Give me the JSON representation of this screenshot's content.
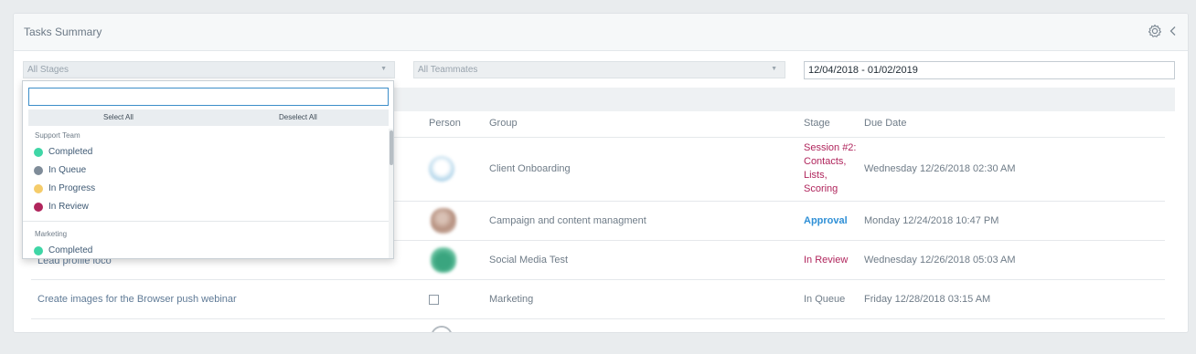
{
  "panel": {
    "title": "Tasks Summary"
  },
  "filters": {
    "stages_placeholder": "All Stages",
    "teammates_placeholder": "All Teammates",
    "date_range": "12/04/2018 - 01/02/2019"
  },
  "table": {
    "headers": [
      "Person",
      "Group",
      "Stage",
      "Due Date"
    ],
    "rows": [
      {
        "task": "",
        "group": "Client Onboarding",
        "stage": "Session #2: Contacts, Lists, Scoring",
        "stage_color": "#b0255c",
        "due": "Wednesday 12/26/2018 02:30 AM"
      },
      {
        "task": "",
        "group": "Campaign and content managment",
        "stage": "Approval",
        "stage_color": "#2e8fd6",
        "due": "Monday 12/24/2018 10:47 PM"
      },
      {
        "task": "Lead profile loco",
        "group": "Social Media Test",
        "stage": "In Review",
        "stage_color": "#b0255c",
        "due": "Wednesday 12/26/2018 05:03 AM"
      },
      {
        "task": "Create images for the Browser push webinar",
        "group": "Marketing",
        "stage": "In Queue",
        "stage_color": "#6f7c88",
        "due": "Friday 12/28/2018 03:15 AM"
      }
    ]
  },
  "dropdown": {
    "search_value": "",
    "select_all": "Select All",
    "deselect_all": "Deselect All",
    "groups": [
      {
        "name": "Support Team",
        "items": [
          {
            "label": "Completed",
            "color": "#3fd6a6"
          },
          {
            "label": "In Queue",
            "color": "#7f8c99"
          },
          {
            "label": "In Progress",
            "color": "#f5cc6a"
          },
          {
            "label": "In Review",
            "color": "#b0255c"
          }
        ]
      },
      {
        "name": "Marketing",
        "items": [
          {
            "label": "Completed",
            "color": "#3fd6a6"
          }
        ]
      }
    ]
  },
  "icons": {
    "settings": "gear-icon",
    "collapse": "chevron-left-icon",
    "select_caret": "caret-down-icon"
  }
}
